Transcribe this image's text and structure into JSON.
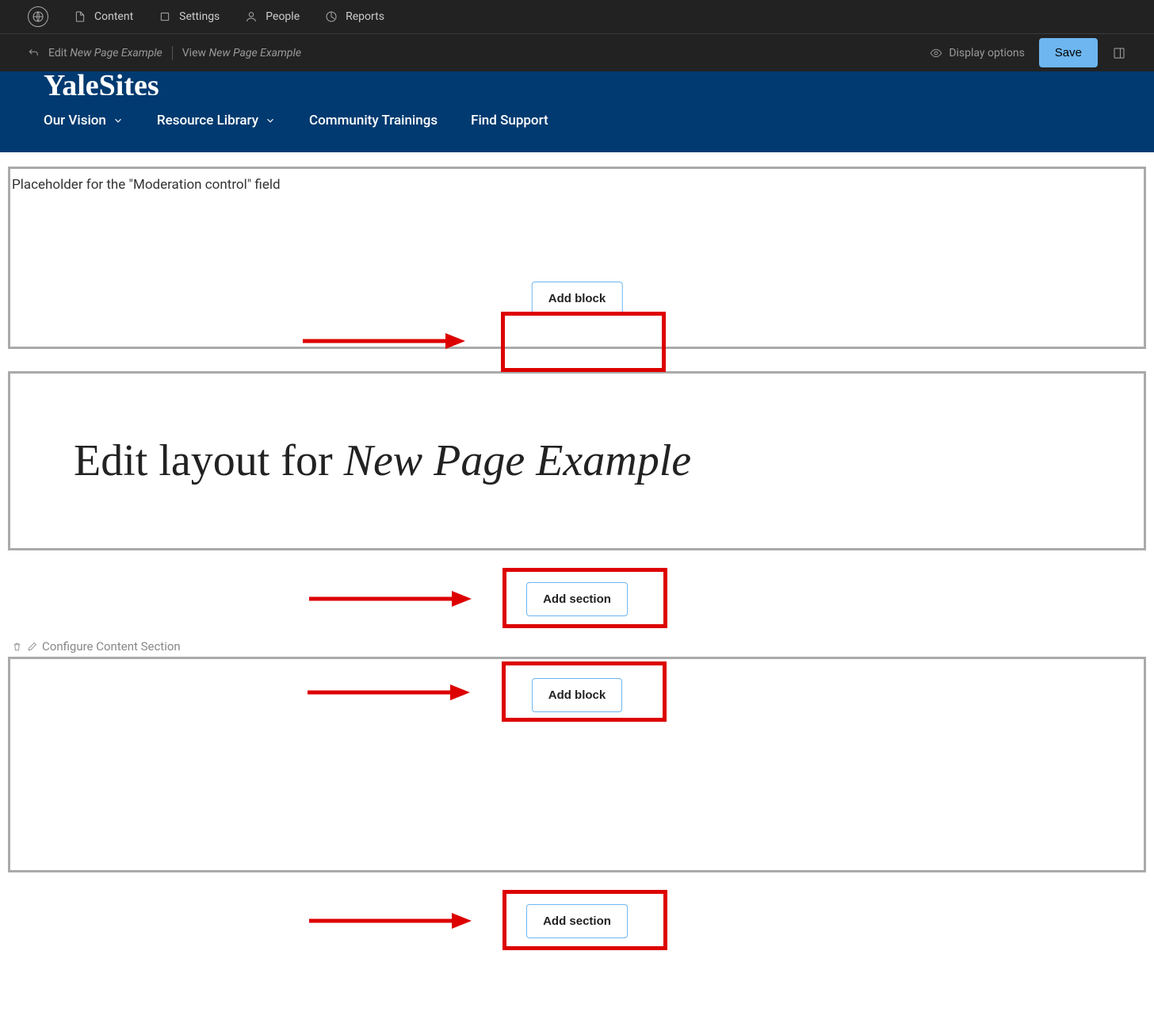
{
  "topbar": {
    "items": [
      {
        "label": "Content"
      },
      {
        "label": "Settings"
      },
      {
        "label": "People"
      },
      {
        "label": "Reports"
      }
    ]
  },
  "subbar": {
    "edit_prefix": "Edit ",
    "edit_page": "New Page Example",
    "view_prefix": "View ",
    "view_page": "New Page Example",
    "display_options": "Display options",
    "save": "Save"
  },
  "site": {
    "title": "YaleSites",
    "nav": [
      {
        "label": "Our Vision",
        "dropdown": true
      },
      {
        "label": "Resource Library",
        "dropdown": true
      },
      {
        "label": "Community Trainings",
        "dropdown": false
      },
      {
        "label": "Find Support",
        "dropdown": false
      }
    ]
  },
  "section1": {
    "placeholder": "Placeholder for the \"Moderation control\" field",
    "add_block": "Add block"
  },
  "title_section": {
    "prefix": "Edit layout for ",
    "page_name": "New Page Example"
  },
  "add_section_1": "Add section",
  "config_section": {
    "label": "Configure Content Section",
    "add_block": "Add block"
  },
  "add_section_2": "Add section"
}
